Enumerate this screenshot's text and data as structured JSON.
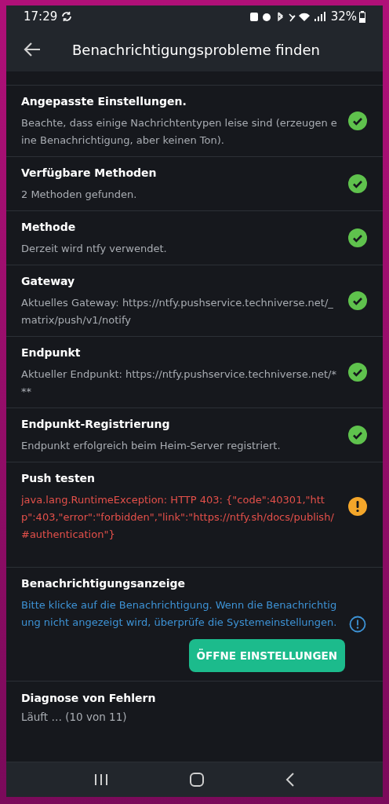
{
  "status_bar": {
    "time": "17:29",
    "battery": "32%"
  },
  "app_bar": {
    "title": "Benachrichtigungsprobleme finden"
  },
  "checks": [
    {
      "title": "Angepasste Einstellungen.",
      "detail": "Beachte, dass einige Nachrichtentypen leise sind (erzeugen eine Benachrichtigung, aber keinen Ton).",
      "kind": "success"
    },
    {
      "title": "Verfügbare Methoden",
      "detail": "2 Methoden gefunden.",
      "kind": "success"
    },
    {
      "title": "Methode",
      "detail": "Derzeit wird ntfy verwendet.",
      "kind": "success"
    },
    {
      "title": "Gateway",
      "detail": "Aktuelles Gateway: https://ntfy.pushservice.techniverse.net/_matrix/push/v1/notify",
      "kind": "success"
    },
    {
      "title": "Endpunkt",
      "detail": "Aktueller Endpunkt: https://ntfy.pushservice.techniverse.net/***",
      "kind": "success"
    },
    {
      "title": "Endpunkt-Registrierung",
      "detail": "Endpunkt erfolgreich beim Heim-Server registriert.",
      "kind": "success"
    },
    {
      "title": "Push testen",
      "detail": "java.lang.RuntimeException: HTTP 403: {\"code\":40301,\"http\":403,\"error\":\"forbidden\",\"link\":\"https://ntfy.sh/docs/publish/#authentication\"}",
      "kind": "error"
    },
    {
      "title": "Benachrichtigungsanzeige",
      "detail": "Bitte klicke auf die Benachrichtigung. Wenn die Benachrichtigung nicht angezeigt wird, überprüfe die Systemeinstellungen.",
      "kind": "info",
      "action": "ÖFFNE EINSTELLUNGEN"
    },
    {
      "title": "Diagnose von Fehlern",
      "detail": "Läuft … (10 von 11)",
      "kind": "running"
    }
  ]
}
